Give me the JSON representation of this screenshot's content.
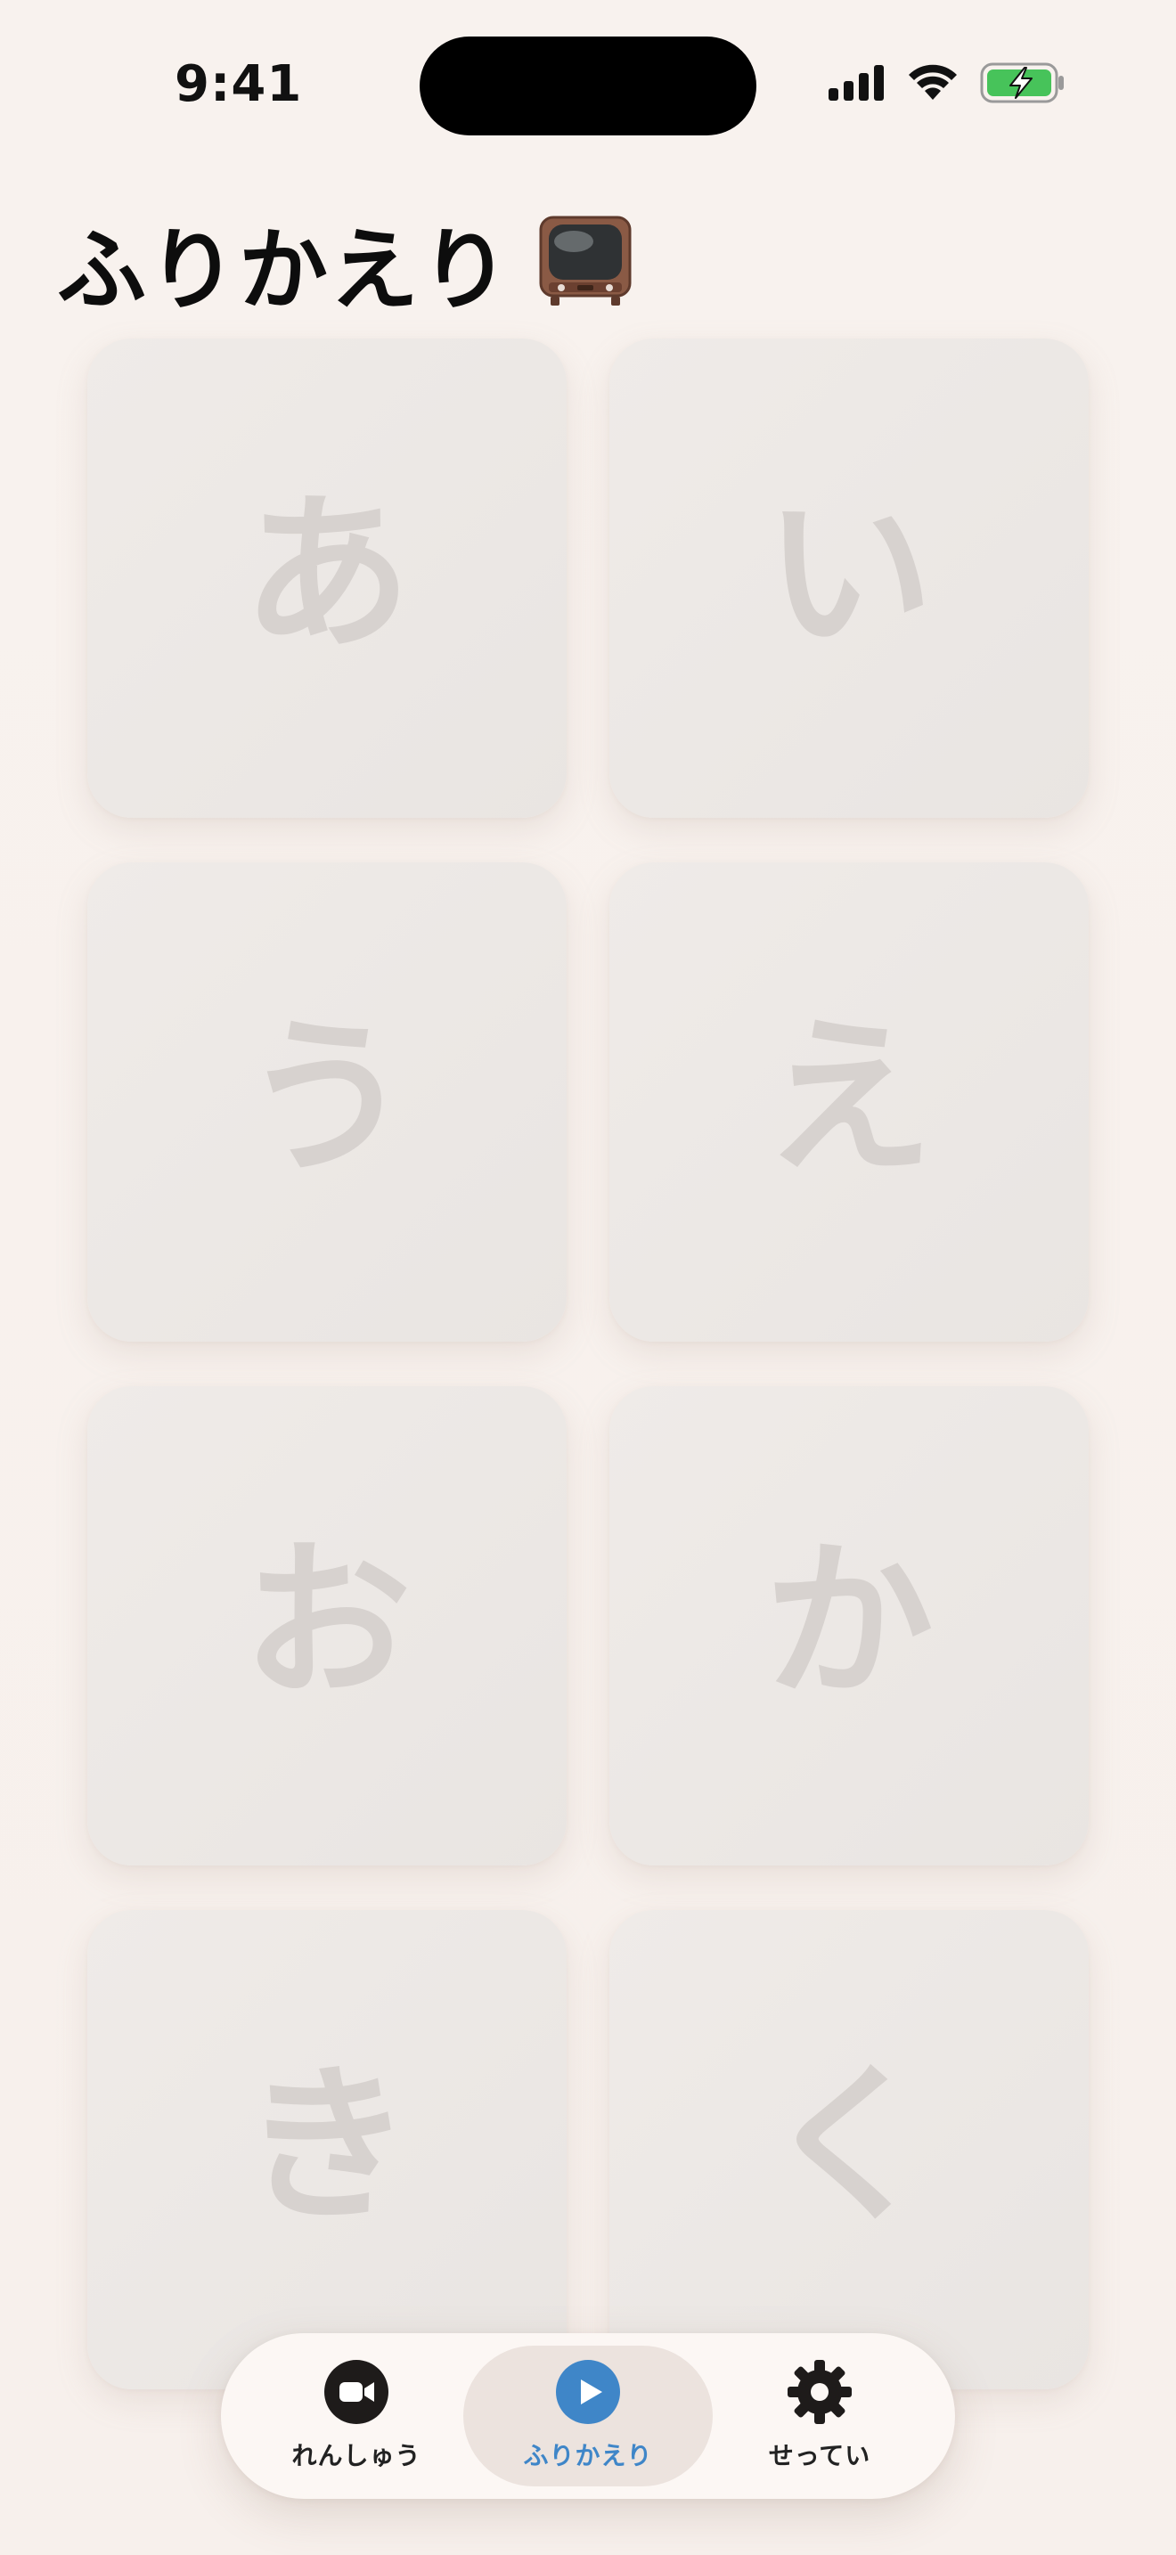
{
  "status_bar": {
    "time": "9:41"
  },
  "page": {
    "title": "ふりかえり"
  },
  "grid": {
    "cards": [
      {
        "char": "あ"
      },
      {
        "char": "い"
      },
      {
        "char": "う"
      },
      {
        "char": "え"
      },
      {
        "char": "お"
      },
      {
        "char": "か"
      },
      {
        "char": "き"
      },
      {
        "char": "く"
      }
    ]
  },
  "tab_bar": {
    "tabs": [
      {
        "label": "れんしゅう",
        "icon": "video-camera-icon"
      },
      {
        "label": "ふりかえり",
        "icon": "play-circle-icon"
      },
      {
        "label": "せってい",
        "icon": "gear-icon"
      }
    ],
    "active_color": "#3f86c8"
  },
  "colors": {
    "background": "#f8f1ed",
    "card": "#ece8e5",
    "card_char": "#d7d2cf",
    "battery": "#47c35a"
  }
}
